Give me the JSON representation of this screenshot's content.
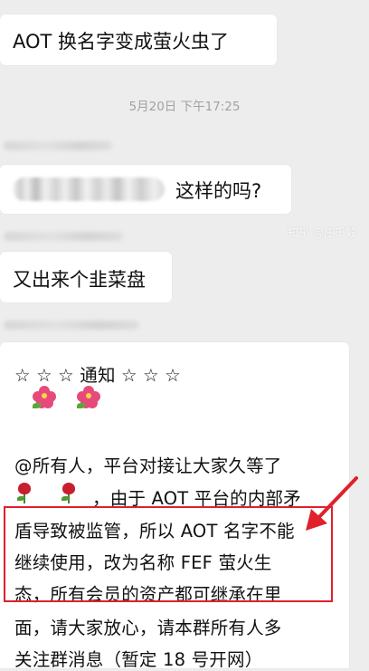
{
  "messages": [
    {
      "text": "AOT 换名字变成萤火虫了"
    },
    {
      "text": "这样的吗?"
    },
    {
      "text": "又出来个韭菜盘"
    }
  ],
  "timestamp": "5月20日 下午17:25",
  "notice": {
    "header": "☆ ☆ ☆ 通知 ☆ ☆ ☆",
    "lines": [
      "@所有人，平台对接让大家久等了",
      "，由于 AOT 平台的内部矛",
      "盾导致被监管，所以 AOT 名字不能",
      "继续使用，改为名称 FEF 萤火生",
      "态，所有会员的资产都可继承在里",
      "面，请大家放心，请本群所有人多",
      "关注群消息（暂定 18 号开网）"
    ]
  },
  "watermark": "知乎 @庄千毅",
  "colors": {
    "highlight_box": "#e0202a",
    "arrow": "#e0202a",
    "bubble": "#ffffff",
    "background": "#ededed"
  }
}
